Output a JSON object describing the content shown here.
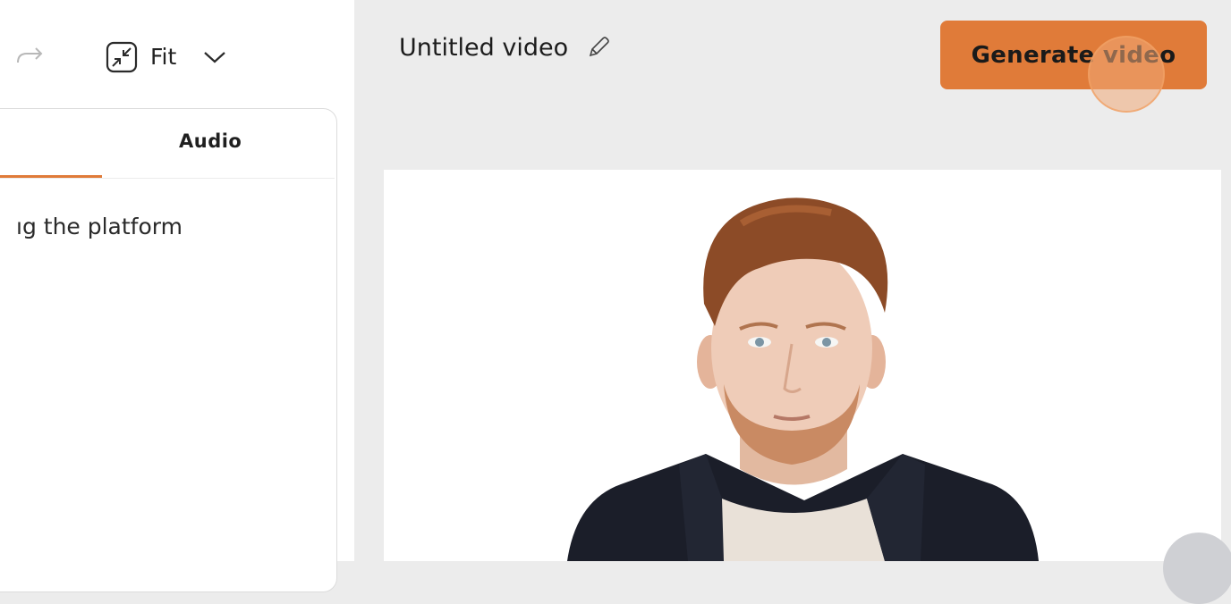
{
  "toolbar": {
    "redo_icon": "redo-icon",
    "fit_icon": "fit-screen-icon",
    "zoom_label": "Fit",
    "zoom_dropdown_icon": "chevron-down-icon"
  },
  "tabs": {
    "audio_label": "Audio",
    "accent_color": "#e07b39"
  },
  "script": {
    "visible_text": "ıg the platform"
  },
  "header": {
    "video_title": "Untitled video",
    "edit_icon": "pencil-icon",
    "generate_label": "Generate video",
    "generate_color": "#e07b39"
  },
  "canvas": {
    "background": "#ffffff",
    "avatar": "avatar-presenter"
  }
}
